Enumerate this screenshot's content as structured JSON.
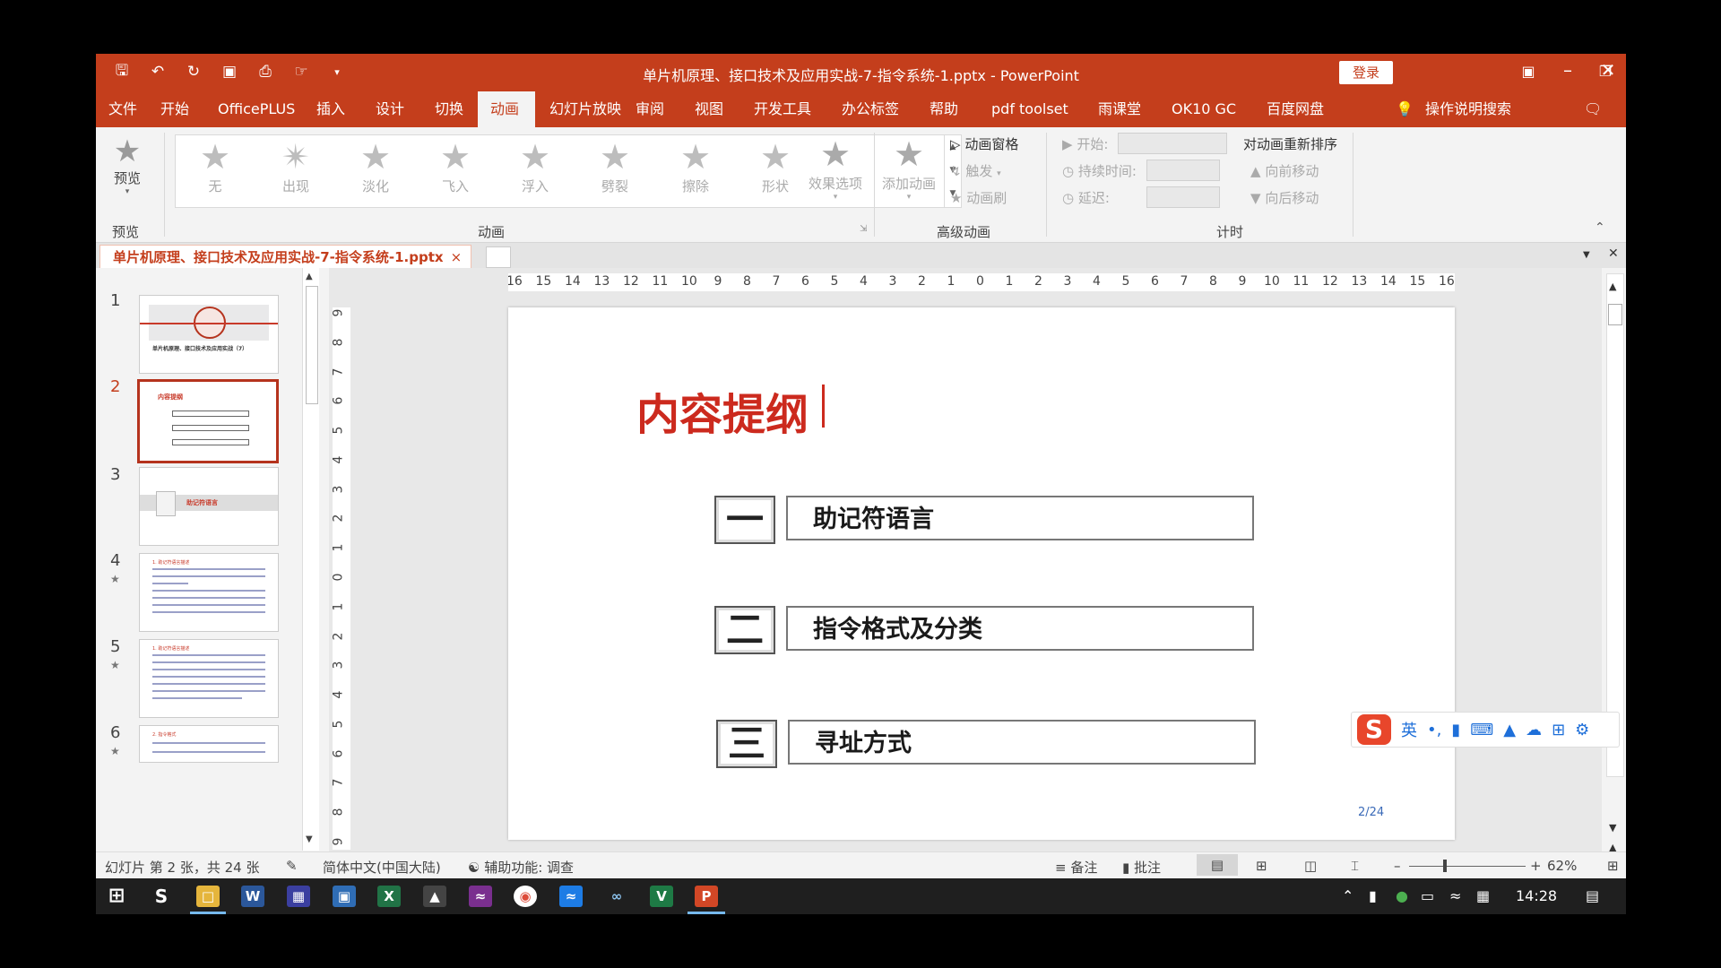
{
  "window": {
    "title": "单片机原理、接口技术及应用实战-7-指令系统-1.pptx  -  PowerPoint",
    "login_label": "登录",
    "controls": [
      "ribbon-display",
      "minimize",
      "restore",
      "close"
    ]
  },
  "tabs": [
    {
      "label": "文件",
      "active": false
    },
    {
      "label": "开始",
      "active": false
    },
    {
      "label": "OfficePLUS",
      "active": false
    },
    {
      "label": "插入",
      "active": false
    },
    {
      "label": "设计",
      "active": false
    },
    {
      "label": "切换",
      "active": false
    },
    {
      "label": "动画",
      "active": true
    },
    {
      "label": "幻灯片放映",
      "active": false
    },
    {
      "label": "审阅",
      "active": false
    },
    {
      "label": "视图",
      "active": false
    },
    {
      "label": "开发工具",
      "active": false
    },
    {
      "label": "办公标签",
      "active": false
    },
    {
      "label": "帮助",
      "active": false
    },
    {
      "label": "pdf toolset",
      "active": false
    },
    {
      "label": "雨课堂",
      "active": false
    },
    {
      "label": "OK10 GC",
      "active": false
    },
    {
      "label": "百度网盘",
      "active": false
    }
  ],
  "tell_me": "操作说明搜索",
  "ribbon": {
    "preview": {
      "button": "预览",
      "group": "预览"
    },
    "animation": {
      "group": "动画",
      "effects": [
        "无",
        "出现",
        "淡化",
        "飞入",
        "浮入",
        "劈裂",
        "擦除",
        "形状"
      ],
      "effect_options": "效果选项"
    },
    "advanced": {
      "group": "高级动画",
      "add_animation": "添加动画",
      "pane": "动画窗格",
      "trigger": "触发",
      "painter": "动画刷"
    },
    "timing": {
      "group": "计时",
      "start": "开始:",
      "duration": "持续时间:",
      "delay": "延迟:",
      "reorder": "对动画重新排序",
      "move_earlier": "向前移动",
      "move_later": "向后移动"
    }
  },
  "doc_tab": {
    "label": "单片机原理、接口技术及应用实战-7-指令系统-1.pptx",
    "close": "×"
  },
  "thumbnails": [
    {
      "num": "1",
      "title": "单片机原理、接口技术及应用实战（7）",
      "selected": false,
      "star": false
    },
    {
      "num": "2",
      "title": "内容提纲",
      "selected": true,
      "star": false
    },
    {
      "num": "3",
      "title": "助记符语言",
      "selected": false,
      "star": false
    },
    {
      "num": "4",
      "title": "1. 助记符语言描述",
      "selected": false,
      "star": true
    },
    {
      "num": "5",
      "title": "1. 助记符语言描述",
      "selected": false,
      "star": true
    },
    {
      "num": "6",
      "title": "2. 指令格式",
      "selected": false,
      "star": true
    }
  ],
  "ruler": {
    "h": [
      "16",
      "15",
      "14",
      "13",
      "12",
      "11",
      "10",
      "9",
      "8",
      "7",
      "6",
      "5",
      "4",
      "3",
      "2",
      "1",
      "0",
      "1",
      "2",
      "3",
      "4",
      "5",
      "6",
      "7",
      "8",
      "9",
      "10",
      "11",
      "12",
      "13",
      "14",
      "15",
      "16"
    ],
    "v": [
      "9",
      "8",
      "7",
      "6",
      "5",
      "4",
      "3",
      "2",
      "1",
      "0",
      "1",
      "2",
      "3",
      "4",
      "5",
      "6",
      "7",
      "8",
      "9"
    ]
  },
  "slide": {
    "title": "内容提纲",
    "items": [
      {
        "number": "一",
        "text": "助记符语言"
      },
      {
        "number": "二",
        "text": "指令格式及分类"
      },
      {
        "number": "三",
        "text": "寻址方式"
      }
    ],
    "page": "2/24"
  },
  "ime": {
    "mode": "英",
    "logo": "S"
  },
  "status": {
    "slide_info": "幻灯片 第 2 张，共 24 张",
    "language": "简体中文(中国大陆)",
    "accessibility": "辅助功能: 调查",
    "notes": "备注",
    "comments": "批注",
    "zoom": "62%"
  },
  "taskbar": {
    "time": "14:28",
    "apps": [
      "windows-start",
      "sogou",
      "file-explorer",
      "word",
      "app-a",
      "app-b",
      "excel",
      "app-c",
      "app-d",
      "chrome",
      "app-e",
      "app-f",
      "app-g",
      "powerpoint"
    ]
  },
  "colors": {
    "accent": "#c43e1c",
    "slide_title": "#cc2a1e"
  }
}
